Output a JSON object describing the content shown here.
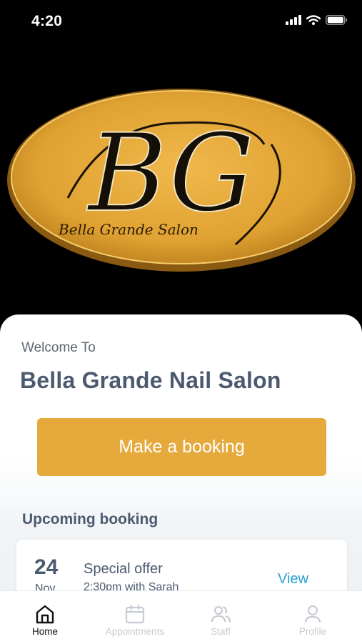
{
  "status_bar": {
    "time": "4:20"
  },
  "hero": {
    "logo_initials": "BG",
    "logo_tagline": "Bella Grande Salon"
  },
  "welcome": {
    "label": "Welcome To",
    "salon_name": "Bella Grande Nail Salon"
  },
  "cta": {
    "label": "Make a booking"
  },
  "upcoming": {
    "title": "Upcoming booking",
    "booking": {
      "day": "24",
      "month": "Nov",
      "title": "Special offer",
      "subtitle": "2:30pm with Sarah",
      "action": "View"
    }
  },
  "tabs": [
    {
      "label": "Home",
      "icon": "home-icon",
      "active": true
    },
    {
      "label": "Appointments",
      "icon": "calendar-icon",
      "active": false
    },
    {
      "label": "Staff",
      "icon": "users-icon",
      "active": false
    },
    {
      "label": "Profile",
      "icon": "user-icon",
      "active": false
    }
  ],
  "colors": {
    "accent": "#e6a93c",
    "heading": "#4c5a70",
    "link": "#2b9fd3",
    "tab_inactive": "#c6ccd3"
  }
}
